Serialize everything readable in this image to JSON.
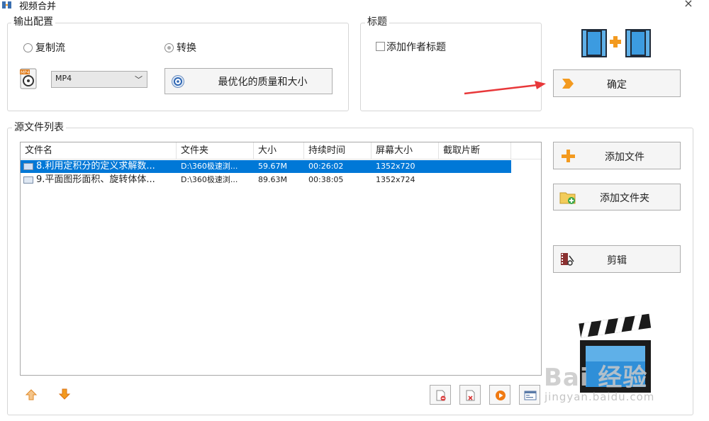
{
  "window": {
    "title": "视频合并",
    "close_glyph": "×"
  },
  "output_config": {
    "group_label": "输出配置",
    "radio_copy_stream": {
      "label": "复制流",
      "checked": false
    },
    "radio_convert": {
      "label": "转换",
      "checked": true
    },
    "format": {
      "selected": "MP4",
      "icon": "mp4-file-icon"
    },
    "quality_button": {
      "label": "最优化的质量和大小",
      "icon": "quality-settings-icon"
    }
  },
  "title_group": {
    "group_label": "标题",
    "add_author_title": {
      "label": "添加作者标题",
      "checked": false
    }
  },
  "confirm_button": {
    "label": "确定",
    "icon": "arrow-right-icon"
  },
  "annotation_arrow_color": "#e8383a",
  "source_list": {
    "group_label": "源文件列表",
    "columns": [
      "文件名",
      "文件夹",
      "大小",
      "持续时间",
      "屏幕大小",
      "截取片断"
    ],
    "rows": [
      {
        "name": "8.利用定积分的定义求解数...",
        "folder": "D:\\360极速浏...",
        "size": "59.67M",
        "duration": "00:26:02",
        "screen": "1352x720",
        "clip": "",
        "selected": true
      },
      {
        "name": "9.平面图形面积、旋转体体...",
        "folder": "D:\\360极速浏...",
        "size": "89.63M",
        "duration": "00:38:05",
        "screen": "1352x724",
        "clip": "",
        "selected": false
      }
    ]
  },
  "side_buttons": {
    "add_file": {
      "label": "添加文件",
      "icon": "plus-icon"
    },
    "add_folder": {
      "label": "添加文件夹",
      "icon": "folder-add-icon"
    },
    "edit": {
      "label": "剪辑",
      "icon": "film-scissors-icon"
    }
  },
  "bottom_tools": [
    "remove-file-icon",
    "delete-file-icon",
    "play-icon",
    "info-icon"
  ],
  "move_buttons": [
    "move-up-icon",
    "move-down-icon"
  ],
  "watermark": {
    "logo": "Bai 经验",
    "url": "jingyan.baidu.com"
  },
  "colors": {
    "selection": "#0078d7",
    "accent_orange": "#f39a1f"
  }
}
